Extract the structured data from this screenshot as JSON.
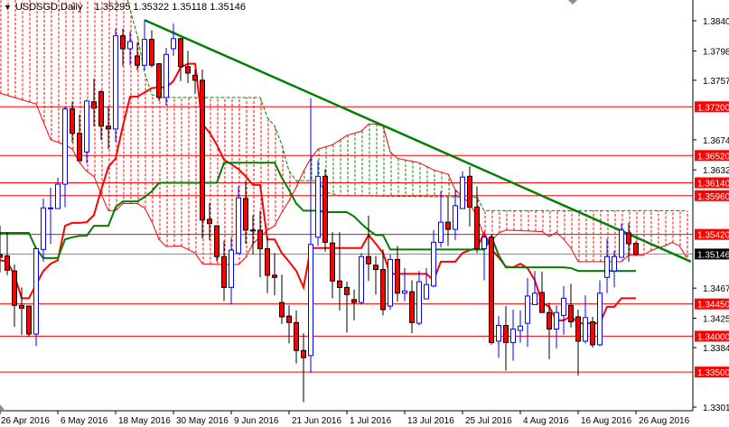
{
  "header": {
    "collapse_icon": "triangle-down-icon",
    "symbol": "USDSGD,Daily",
    "open": "1.35295",
    "high": "1.35322",
    "low": "1.35118",
    "close": "1.35146"
  },
  "colors": {
    "bull": "#0000ff",
    "bear": "#ff0000",
    "tenkan": "#ff0000",
    "kijun": "#008000",
    "trendline": "#008000",
    "level": "#ff0000",
    "current": "#778899"
  },
  "chart_data": {
    "type": "candlestick",
    "title": "USDSGD,Daily",
    "ylim": [
      1.3301,
      1.384
    ],
    "y_ticks": [
      "1.38400",
      "1.37980",
      "1.37570",
      "1.36740",
      "1.36320",
      "1.34670",
      "1.34250",
      "1.33840",
      "1.33010"
    ],
    "x_ticks": [
      {
        "bar": 0,
        "label": "26 Apr 2016"
      },
      {
        "bar": 8,
        "label": "6 May 2016"
      },
      {
        "bar": 16,
        "label": "18 May 2016"
      },
      {
        "bar": 24,
        "label": "30 May 2016"
      },
      {
        "bar": 32,
        "label": "9 Jun 2016"
      },
      {
        "bar": 40,
        "label": "21 Jun 2016"
      },
      {
        "bar": 48,
        "label": "1 Jul 2016"
      },
      {
        "bar": 56,
        "label": "13 Jul 2016"
      },
      {
        "bar": 64,
        "label": "25 Jul 2016"
      },
      {
        "bar": 72,
        "label": "4 Aug 2016"
      },
      {
        "bar": 80,
        "label": "16 Aug 2016"
      },
      {
        "bar": 88,
        "label": "26 Aug 2016"
      }
    ],
    "ohlc": [
      [
        1.3514,
        1.3554,
        1.3489,
        1.351
      ],
      [
        1.3512,
        1.3545,
        1.3485,
        1.3492
      ],
      [
        1.3491,
        1.35,
        1.3413,
        1.3443
      ],
      [
        1.3443,
        1.3468,
        1.3402,
        1.3439
      ],
      [
        1.3442,
        1.3441,
        1.3399,
        1.3403
      ],
      [
        1.3403,
        1.3525,
        1.3386,
        1.3522
      ],
      [
        1.3521,
        1.3592,
        1.3504,
        1.3579
      ],
      [
        1.3578,
        1.3607,
        1.3529,
        1.3579
      ],
      [
        1.3578,
        1.3621,
        1.3578,
        1.3612
      ],
      [
        1.3612,
        1.372,
        1.358,
        1.3717
      ],
      [
        1.3717,
        1.3727,
        1.367,
        1.3683
      ],
      [
        1.3683,
        1.3709,
        1.3645,
        1.3645
      ],
      [
        1.3657,
        1.373,
        1.3641,
        1.3728
      ],
      [
        1.3727,
        1.3759,
        1.3693,
        1.3718
      ],
      [
        1.3741,
        1.3743,
        1.3674,
        1.3693
      ],
      [
        1.3693,
        1.372,
        1.3661,
        1.3689
      ],
      [
        1.3689,
        1.3829,
        1.3671,
        1.3819
      ],
      [
        1.3819,
        1.3829,
        1.3777,
        1.3801
      ],
      [
        1.3801,
        1.3825,
        1.3778,
        1.3811
      ],
      [
        1.3791,
        1.381,
        1.3771,
        1.3778
      ],
      [
        1.3778,
        1.3841,
        1.3771,
        1.3814
      ],
      [
        1.3814,
        1.3827,
        1.3775,
        1.3778
      ],
      [
        1.378,
        1.3781,
        1.3728,
        1.3733
      ],
      [
        1.3733,
        1.3802,
        1.3722,
        1.3793
      ],
      [
        1.3801,
        1.3836,
        1.3791,
        1.3815
      ],
      [
        1.3815,
        1.3816,
        1.3756,
        1.3776
      ],
      [
        1.3776,
        1.3798,
        1.3753,
        1.3767
      ],
      [
        1.3764,
        1.3772,
        1.3738,
        1.3757
      ],
      [
        1.3757,
        1.3772,
        1.3536,
        1.3562
      ],
      [
        1.3563,
        1.3586,
        1.3534,
        1.3557
      ],
      [
        1.3554,
        1.3554,
        1.3504,
        1.3511
      ],
      [
        1.3511,
        1.3533,
        1.3449,
        1.3468
      ],
      [
        1.3468,
        1.3538,
        1.3444,
        1.352
      ],
      [
        1.3516,
        1.3609,
        1.3516,
        1.3593
      ],
      [
        1.3592,
        1.3617,
        1.3529,
        1.3548
      ],
      [
        1.3548,
        1.3569,
        1.3514,
        1.3547
      ],
      [
        1.3548,
        1.3575,
        1.3482,
        1.3522
      ],
      [
        1.3522,
        1.3539,
        1.346,
        1.3485
      ],
      [
        1.3485,
        1.3516,
        1.3457,
        1.3482
      ],
      [
        1.3447,
        1.3486,
        1.3417,
        1.3427
      ],
      [
        1.3428,
        1.3443,
        1.339,
        1.3419
      ],
      [
        1.3419,
        1.3436,
        1.3362,
        1.338
      ],
      [
        1.338,
        1.3404,
        1.3308,
        1.337
      ],
      [
        1.3373,
        1.3732,
        1.3349,
        1.3528
      ],
      [
        1.3538,
        1.3645,
        1.3526,
        1.3623
      ],
      [
        1.3623,
        1.3633,
        1.3518,
        1.3531
      ],
      [
        1.353,
        1.3545,
        1.3453,
        1.3477
      ],
      [
        1.3477,
        1.3545,
        1.3436,
        1.3468
      ],
      [
        1.3468,
        1.3476,
        1.3405,
        1.3458
      ],
      [
        1.3451,
        1.3465,
        1.3422,
        1.3447
      ],
      [
        1.3447,
        1.3516,
        1.3444,
        1.3511
      ],
      [
        1.3511,
        1.3568,
        1.3477,
        1.3501
      ],
      [
        1.3499,
        1.3512,
        1.3458,
        1.3493
      ],
      [
        1.3493,
        1.3521,
        1.3429,
        1.3437
      ],
      [
        1.3442,
        1.3514,
        1.3437,
        1.3507
      ],
      [
        1.3507,
        1.3526,
        1.3448,
        1.346
      ],
      [
        1.346,
        1.3495,
        1.3449,
        1.3463
      ],
      [
        1.3462,
        1.3478,
        1.3404,
        1.3419
      ],
      [
        1.3418,
        1.3491,
        1.3415,
        1.3476
      ],
      [
        1.3452,
        1.3495,
        1.3452,
        1.3472
      ],
      [
        1.347,
        1.3548,
        1.3468,
        1.3531
      ],
      [
        1.3531,
        1.3602,
        1.3524,
        1.3559
      ],
      [
        1.3559,
        1.3594,
        1.3526,
        1.3549
      ],
      [
        1.3549,
        1.3604,
        1.3534,
        1.3582
      ],
      [
        1.3578,
        1.363,
        1.3578,
        1.3622
      ],
      [
        1.3623,
        1.3637,
        1.3553,
        1.358
      ],
      [
        1.358,
        1.3609,
        1.3516,
        1.3522
      ],
      [
        1.3522,
        1.354,
        1.3478,
        1.3538
      ],
      [
        1.3538,
        1.3541,
        1.3388,
        1.3391
      ],
      [
        1.3393,
        1.3428,
        1.337,
        1.3415
      ],
      [
        1.3415,
        1.3442,
        1.3352,
        1.3391
      ],
      [
        1.3391,
        1.3437,
        1.3366,
        1.341
      ],
      [
        1.3408,
        1.3436,
        1.3391,
        1.3414
      ],
      [
        1.3418,
        1.3481,
        1.3385,
        1.3456
      ],
      [
        1.3444,
        1.3491,
        1.3444,
        1.346
      ],
      [
        1.3461,
        1.349,
        1.3433,
        1.3433
      ],
      [
        1.3433,
        1.3447,
        1.3368,
        1.341
      ],
      [
        1.341,
        1.3443,
        1.3383,
        1.3433
      ],
      [
        1.3429,
        1.347,
        1.3402,
        1.3453
      ],
      [
        1.3443,
        1.3473,
        1.3412,
        1.342
      ],
      [
        1.3427,
        1.3437,
        1.3345,
        1.3393
      ],
      [
        1.3393,
        1.3457,
        1.339,
        1.3426
      ],
      [
        1.342,
        1.3427,
        1.3384,
        1.3388
      ],
      [
        1.3388,
        1.3478,
        1.3386,
        1.346
      ],
      [
        1.3482,
        1.3536,
        1.346,
        1.3511
      ],
      [
        1.3491,
        1.3519,
        1.3468,
        1.3511
      ],
      [
        1.351,
        1.3557,
        1.351,
        1.3548
      ],
      [
        1.3544,
        1.3558,
        1.3504,
        1.3529
      ],
      [
        1.35295,
        1.35322,
        1.35118,
        1.35146
      ]
    ],
    "ichimoku": {
      "tenkan": [
        1.3506,
        1.3504,
        1.3485,
        1.3453,
        1.3453,
        1.3472,
        1.3491,
        1.3501,
        1.3506,
        1.3554,
        1.3558,
        1.3558,
        1.3559,
        1.3569,
        1.3604,
        1.3636,
        1.3648,
        1.3693,
        1.3734,
        1.3734,
        1.374,
        1.3746,
        1.3747,
        1.3747,
        1.3756,
        1.3775,
        1.378,
        1.378,
        1.3696,
        1.3684,
        1.3667,
        1.3646,
        1.364,
        1.3633,
        1.3623,
        1.3611,
        1.3611,
        1.3535,
        1.3535,
        1.3516,
        1.3504,
        1.3491,
        1.3468,
        1.3523,
        1.3523,
        1.3523,
        1.3523,
        1.3523,
        1.3523,
        1.3523,
        1.3523,
        1.3541,
        1.3529,
        1.3516,
        1.3487,
        1.3487,
        1.3487,
        1.3487,
        1.3487,
        1.3487,
        1.3478,
        1.3504,
        1.3504,
        1.3504,
        1.3516,
        1.352,
        1.3523,
        1.3544,
        1.3521,
        1.351,
        1.3497,
        1.3496,
        1.3501,
        1.3495,
        1.3478,
        1.3447,
        1.3441,
        1.3422,
        1.3422,
        1.3428,
        1.3418,
        1.3418,
        1.3418,
        1.3418,
        1.3441,
        1.3441,
        1.3453,
        1.3453,
        1.3453
      ],
      "kijun": [
        [
          0,
          1.3544
        ],
        [
          4,
          1.3544
        ],
        [
          5,
          1.3522
        ],
        [
          6,
          1.3509
        ],
        [
          8,
          1.3509
        ],
        [
          9,
          1.3535
        ],
        [
          10,
          1.3538
        ],
        [
          11,
          1.354
        ],
        [
          12,
          1.354
        ],
        [
          13,
          1.3554
        ],
        [
          15,
          1.3554
        ],
        [
          16,
          1.358
        ],
        [
          17,
          1.3588
        ],
        [
          19,
          1.3588
        ],
        [
          20,
          1.3594
        ],
        [
          21,
          1.3602
        ],
        [
          22,
          1.3614
        ],
        [
          30,
          1.3614
        ],
        [
          31,
          1.3642
        ],
        [
          38,
          1.3642
        ],
        [
          39,
          1.3621
        ],
        [
          40,
          1.3604
        ],
        [
          41,
          1.3585
        ],
        [
          42,
          1.3575
        ],
        [
          44,
          1.3575
        ],
        [
          45,
          1.3573
        ],
        [
          48,
          1.3573
        ],
        [
          49,
          1.3567
        ],
        [
          50,
          1.3557
        ],
        [
          51,
          1.3548
        ],
        [
          52,
          1.3541
        ],
        [
          53,
          1.3541
        ],
        [
          54,
          1.3521
        ],
        [
          67,
          1.3521
        ],
        [
          68,
          1.3539
        ],
        [
          69,
          1.3513
        ],
        [
          70,
          1.3496
        ],
        [
          78,
          1.3496
        ],
        [
          79,
          1.3495
        ],
        [
          80,
          1.3491
        ],
        [
          88,
          1.3491
        ]
      ],
      "senkou_a": [
        [
          0,
          1.3739
        ],
        [
          2,
          1.3733
        ],
        [
          5,
          1.3724
        ],
        [
          6,
          1.3699
        ],
        [
          7,
          1.3674
        ],
        [
          9,
          1.3667
        ],
        [
          10,
          1.3661
        ],
        [
          11,
          1.3642
        ],
        [
          12,
          1.363
        ],
        [
          13,
          1.3623
        ],
        [
          14,
          1.3598
        ],
        [
          15,
          1.3575
        ],
        [
          16,
          1.3575
        ],
        [
          17,
          1.3585
        ],
        [
          19,
          1.3585
        ],
        [
          20,
          1.3579
        ],
        [
          21,
          1.356
        ],
        [
          22,
          1.3535
        ],
        [
          23,
          1.3525
        ],
        [
          25,
          1.3526
        ],
        [
          27,
          1.3516
        ],
        [
          28,
          1.3501
        ],
        [
          31,
          1.35
        ],
        [
          33,
          1.35
        ],
        [
          34,
          1.351
        ],
        [
          35,
          1.3529
        ],
        [
          37,
          1.3548
        ],
        [
          38,
          1.3554
        ],
        [
          39,
          1.3573
        ],
        [
          40,
          1.3589
        ],
        [
          41,
          1.3608
        ],
        [
          42,
          1.363
        ],
        [
          43,
          1.3648
        ],
        [
          44,
          1.3661
        ],
        [
          46,
          1.3667
        ],
        [
          48,
          1.368
        ],
        [
          50,
          1.3686
        ],
        [
          51,
          1.3696
        ],
        [
          52,
          1.3696
        ],
        [
          53,
          1.3693
        ],
        [
          54,
          1.3657
        ],
        [
          55,
          1.3648
        ],
        [
          58,
          1.3642
        ],
        [
          60,
          1.3632
        ],
        [
          62,
          1.3626
        ],
        [
          63,
          1.3604
        ],
        [
          65,
          1.3585
        ],
        [
          66,
          1.3567
        ],
        [
          67,
          1.3539
        ],
        [
          68,
          1.3533
        ],
        [
          69,
          1.3544
        ],
        [
          70,
          1.3548
        ],
        [
          75,
          1.3546
        ],
        [
          76,
          1.3539
        ],
        [
          77,
          1.3545
        ],
        [
          78,
          1.3535
        ],
        [
          79,
          1.3523
        ],
        [
          80,
          1.3504
        ],
        [
          86,
          1.3504
        ],
        [
          87,
          1.3513
        ],
        [
          89,
          1.3513
        ],
        [
          90,
          1.3519
        ],
        [
          91,
          1.3523
        ],
        [
          92,
          1.3526
        ],
        [
          93,
          1.3531
        ],
        [
          94,
          1.3526
        ],
        [
          95,
          1.351
        ]
      ],
      "senkou_b": [
        [
          0,
          1.3894
        ],
        [
          17,
          1.3894
        ],
        [
          18,
          1.3856
        ],
        [
          19,
          1.3819
        ],
        [
          20,
          1.3768
        ],
        [
          21,
          1.3737
        ],
        [
          22,
          1.3733
        ],
        [
          36,
          1.3733
        ],
        [
          37,
          1.3705
        ],
        [
          38,
          1.3693
        ],
        [
          39,
          1.3667
        ],
        [
          40,
          1.363
        ],
        [
          41,
          1.3617
        ],
        [
          44,
          1.3617
        ],
        [
          45,
          1.3601
        ],
        [
          47,
          1.3596
        ],
        [
          66,
          1.3594
        ],
        [
          67,
          1.3575
        ],
        [
          95,
          1.3575
        ]
      ]
    },
    "trendline": [
      [
        20,
        1.3841
      ],
      [
        95.6,
        1.3504
      ]
    ],
    "levels": [
      "1.37200",
      "1.36520",
      "1.36140",
      "1.35960",
      "1.35420",
      "1.34450",
      "1.34000",
      "1.33500"
    ],
    "current_price": "1.35146"
  }
}
